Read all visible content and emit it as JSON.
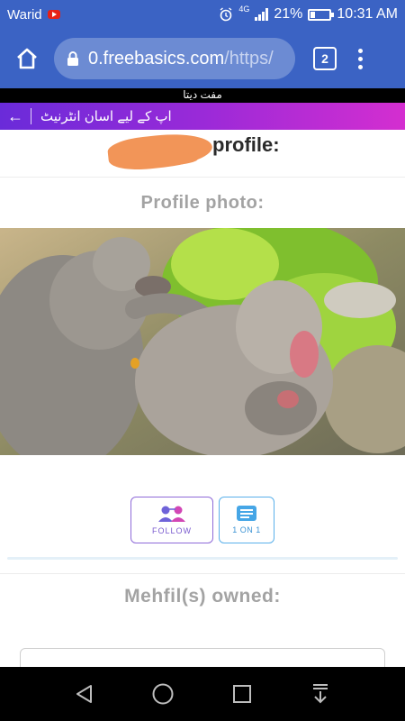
{
  "status": {
    "carrier": "Warid",
    "network": "4G",
    "battery": "21%",
    "time": "10:31 AM"
  },
  "browser": {
    "url_host": "0.freebasics.com",
    "url_rest": "/https/",
    "tab_count": "2"
  },
  "freebasics": {
    "strip_text": "مفت دیتا",
    "banner_text": "اپ کے لیے اسان انٹرنیٹ"
  },
  "profile": {
    "title": "profile:",
    "photo_label": "Profile photo:",
    "follow_label": "FOLLOW",
    "one_on_one_label": "1 ON 1",
    "mehfil_label": "Mehfil(s) owned:"
  },
  "colors": {
    "browser_bar": "#3b63c4",
    "banner_start": "#6a2bd9",
    "banner_end": "#d42ed0",
    "follow_accent": "#8e6ad8",
    "one_on_one_accent": "#46a6e6"
  },
  "icons": {
    "home": "home-icon",
    "lock": "lock-icon",
    "menu": "overflow-menu-icon",
    "back": "arrow-left-icon",
    "follow": "two-people-icon",
    "chat": "chat-icon",
    "nav_back": "triangle-back-icon",
    "nav_home": "circle-home-icon",
    "nav_recent": "square-recent-icon",
    "nav_down": "download-icon"
  }
}
